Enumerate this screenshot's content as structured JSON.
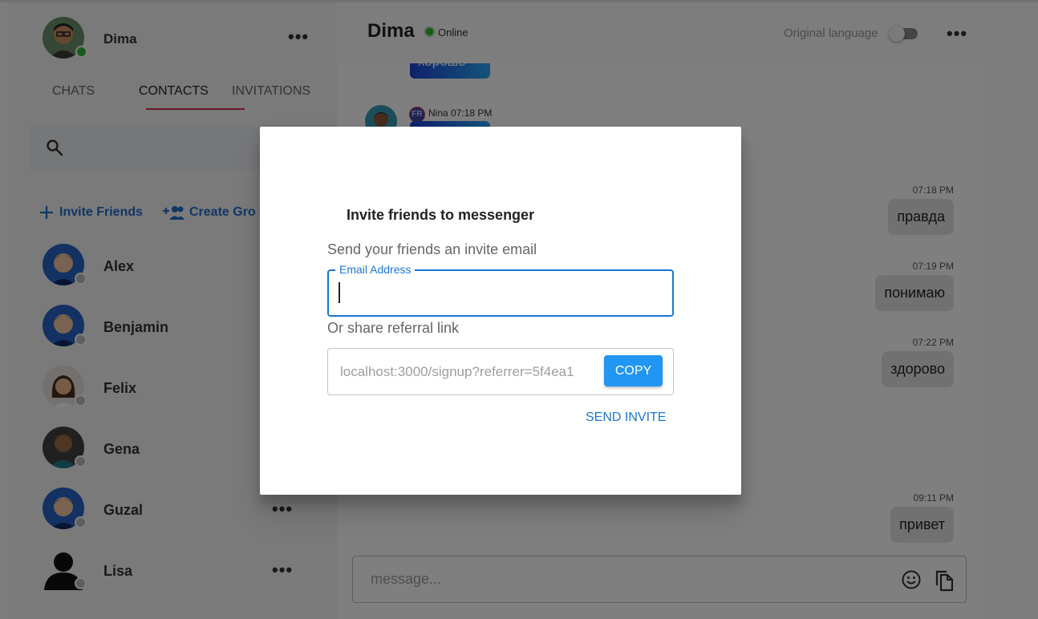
{
  "sidebar": {
    "profile": {
      "name": "Dima"
    },
    "tabs": [
      {
        "label": "CHATS"
      },
      {
        "label": "CONTACTS"
      },
      {
        "label": "INVITATIONS"
      }
    ],
    "actions": {
      "invite_friends": "Invite Friends",
      "create_group": "Create Gro"
    },
    "contacts": [
      {
        "name": "Alex"
      },
      {
        "name": "Benjamin"
      },
      {
        "name": "Felix"
      },
      {
        "name": "Gena"
      },
      {
        "name": "Guzal"
      },
      {
        "name": "Lisa"
      }
    ]
  },
  "chat": {
    "title": "Dima",
    "status": "Online",
    "original_language_label": "Original language",
    "partial_message": "хорошо",
    "sender": {
      "lang": "FR",
      "line": "Nina 07:18 PM"
    },
    "messages": [
      {
        "time": "07:18 PM",
        "text": "правда"
      },
      {
        "time": "07:19 PM",
        "text": "понимаю"
      },
      {
        "time": "07:22 PM",
        "text": "здорово"
      },
      {
        "time": "09:11 PM",
        "text": "привет"
      }
    ],
    "composer": {
      "placeholder": "message..."
    }
  },
  "dialog": {
    "title": "Invite friends to messenger",
    "subtitle": "Send your friends an invite email",
    "email_label": "Email Address",
    "email_value": "",
    "or_share": "Or share referral link",
    "referral_link": "localhost:3000/signup?referrer=5f4ea1",
    "copy_label": "COPY",
    "send_label": "SEND INVITE"
  },
  "colors": {
    "accent": "#1976d2",
    "tab_underline": "#d32f4f",
    "online": "#2fb62f",
    "copy_button": "#2196f3"
  }
}
